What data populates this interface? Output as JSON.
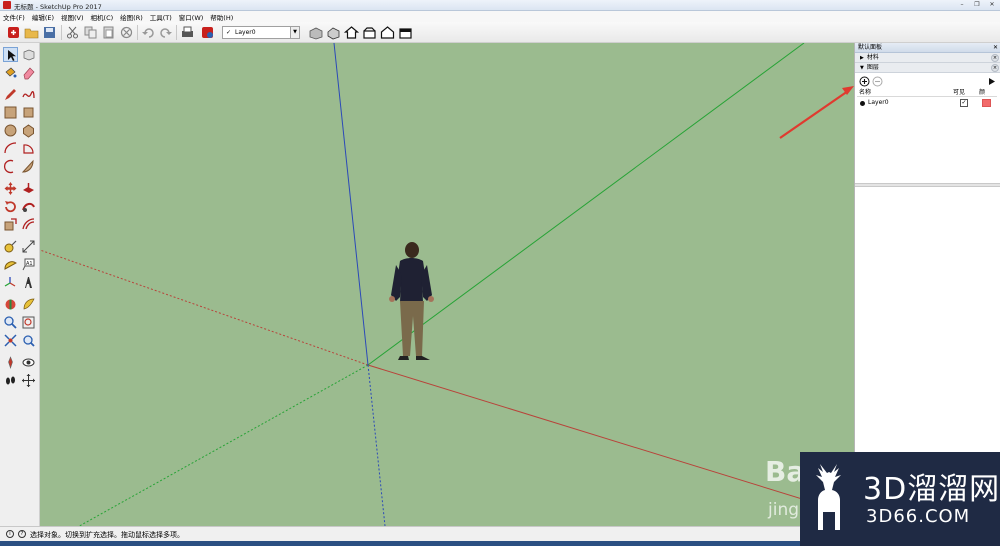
{
  "window": {
    "title": "无标题 - SketchUp Pro 2017",
    "controls": [
      "–",
      "❐",
      "✕"
    ]
  },
  "menu": [
    "文件(F)",
    "编辑(E)",
    "视图(V)",
    "相机(C)",
    "绘图(R)",
    "工具(T)",
    "窗口(W)",
    "帮助(H)"
  ],
  "toolbar": {
    "layer_check": "✓",
    "layer_name": "Layer0",
    "icons": [
      "new-model-icon",
      "open-icon",
      "save-icon",
      "cut-icon",
      "copy-icon",
      "paste-icon",
      "erase-icon",
      "undo-icon",
      "redo-icon",
      "print-icon",
      "model-info-icon",
      "3d-warehouse-icon",
      "iso-view-icon",
      "top-view-icon",
      "front-view-icon",
      "right-view-icon",
      "back-view-icon"
    ]
  },
  "left_tools": [
    "select-icon",
    "component-icon",
    "paint-bucket-icon",
    "eraser-icon",
    "pencil-icon",
    "freehand-icon",
    "rectangle-icon",
    "rotated-rectangle-icon",
    "circle-icon",
    "polygon-icon",
    "arc-icon",
    "pie-icon",
    "two-point-arc-icon",
    "three-point-arc-icon",
    "move-icon",
    "push-pull-icon",
    "rotate-icon",
    "follow-me-icon",
    "scale-icon",
    "offset-icon",
    "tape-measure-icon",
    "dimension-icon",
    "protractor-icon",
    "text-icon",
    "axes-icon",
    "3d-text-icon",
    "section-plane-icon",
    "orbit-icon",
    "pan-icon",
    "zoom-icon",
    "zoom-window-icon",
    "zoom-extents-icon",
    "position-camera-icon",
    "look-around-icon",
    "walk-icon",
    "orbit-alt-icon"
  ],
  "tray": {
    "title": "默认面板",
    "pin": "✕",
    "panels": [
      {
        "label": "材料",
        "expanded": false
      },
      {
        "label": "图层",
        "expanded": true
      }
    ],
    "layers": {
      "headers": {
        "name": "名称",
        "visible": "可见",
        "color": "颜"
      },
      "rows": [
        {
          "name": "Layer0",
          "visible_mark": "✓",
          "color": "#f26b6b"
        }
      ]
    }
  },
  "status": {
    "text": "选择对象。切换到扩充选择。拖动鼠标选择多项。"
  },
  "watermarks": {
    "baidu": "Bai",
    "jing": "jing",
    "brand_cn": "3D溜溜网",
    "brand_url": "3D66.COM"
  },
  "colors": {
    "viewport": "#9bbb8f",
    "axis_red": "#c0392b",
    "axis_green": "#27a336",
    "axis_blue": "#2b49b8",
    "annotation_arrow": "#e03a2f"
  }
}
